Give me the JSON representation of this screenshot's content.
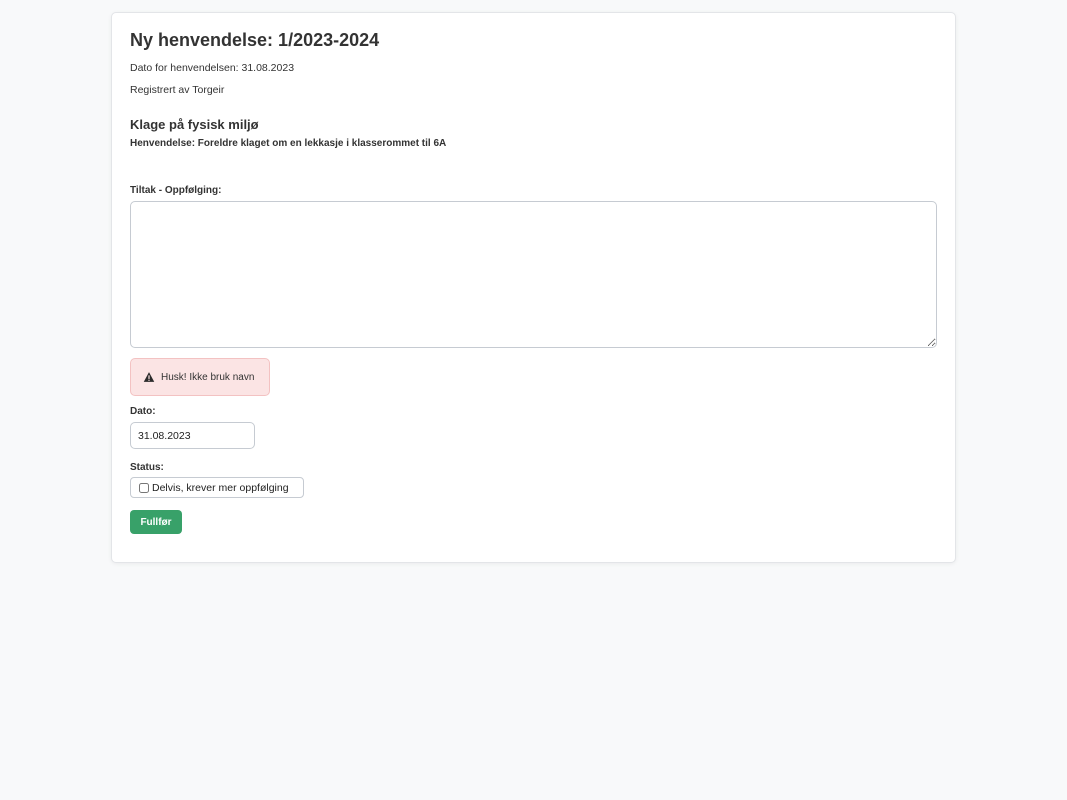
{
  "header": {
    "title": "Ny henvendelse: 1/2023-2024",
    "date_text": "Dato for henvendelsen: 31.08.2023",
    "registered_text": "Registrert av Torgeir"
  },
  "inquiry": {
    "category": "Klage på fysisk miljø",
    "description": "Henvendelse: Foreldre klaget om en lekkasje i klasserommet til 6A"
  },
  "form": {
    "followup_label": "Tiltak - Oppfølging:",
    "followup_value": "",
    "warning_text": "Husk! Ikke bruk navn",
    "date_label": "Dato:",
    "date_value": "31.08.2023",
    "status_label": "Status:",
    "status_option": "Delvis, krever mer oppfølging",
    "status_checked": false,
    "submit_label": "Fullfør"
  },
  "colors": {
    "primary_button": "#38a169",
    "alert_background": "#fbe4e4",
    "alert_border": "#f3c2c2"
  },
  "icons": {
    "warning": "warning-triangle-icon"
  }
}
